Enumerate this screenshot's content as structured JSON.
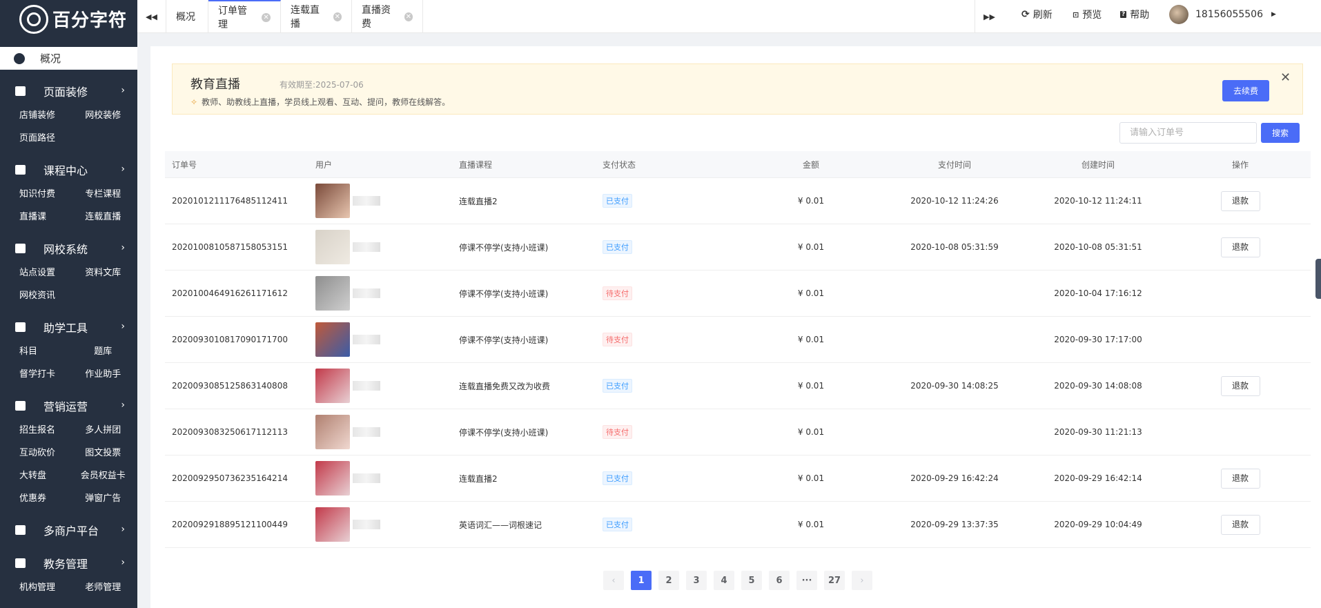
{
  "brand": {
    "name": "百分字符"
  },
  "sidebar": {
    "active": "概况",
    "groups": [
      {
        "title": "页面装修",
        "items": [
          "店铺装修",
          "网校装修",
          "页面路径"
        ]
      },
      {
        "title": "课程中心",
        "items": [
          "知识付费",
          "专栏课程",
          "直播课",
          "连载直播"
        ]
      },
      {
        "title": "网校系统",
        "items": [
          "站点设置",
          "资料文库",
          "网校资讯"
        ]
      },
      {
        "title": "助学工具",
        "items": [
          "科目",
          "题库",
          "督学打卡",
          "作业助手"
        ]
      },
      {
        "title": "营销运营",
        "items": [
          "招生报名",
          "多人拼团",
          "互动砍价",
          "图文投票",
          "大转盘",
          "会员权益卡",
          "优惠券",
          "弹窗广告"
        ]
      },
      {
        "title": "多商户平台",
        "items": []
      },
      {
        "title": "教务管理",
        "items": [
          "机构管理",
          "老师管理"
        ]
      }
    ]
  },
  "topbar": {
    "prev_icon": "◀◀",
    "next_icon": "▶▶",
    "tabs": [
      {
        "label": "概况",
        "closable": false
      },
      {
        "label": "订单管理",
        "closable": true,
        "active": true
      },
      {
        "label": "连载直播",
        "closable": true
      },
      {
        "label": "直播资费",
        "closable": true
      }
    ],
    "refresh": "刷新",
    "preview": "预览",
    "help": "帮助",
    "user": "18156055506"
  },
  "notice": {
    "title": "教育直播",
    "expiry": "有效期至:2025-07-06",
    "desc": "教师、助教线上直播，学员线上观看、互动、提问，教师在线解答。",
    "renew": "去续费"
  },
  "search": {
    "placeholder": "请输入订单号",
    "button": "搜索"
  },
  "table": {
    "headers": [
      "订单号",
      "用户",
      "直播课程",
      "支付状态",
      "金额",
      "支付时间",
      "创建时间",
      "操作"
    ],
    "rows": [
      {
        "order": "20201012111764851124​11",
        "course": "连载直播2",
        "status": "已支付",
        "paid": true,
        "amount": "¥ 0.01",
        "pay_time": "2020-10-12 11:24:26",
        "create_time": "2020-10-12 11:24:11",
        "action": "退款",
        "c1": "#7a4a3a",
        "c2": "#e8c6b0"
      },
      {
        "order": "20201008105871580531​51",
        "course": "停课不停学(支持小班课)",
        "status": "已支付",
        "paid": true,
        "amount": "¥ 0.01",
        "pay_time": "2020-10-08 05:31:59",
        "create_time": "2020-10-08 05:31:51",
        "action": "退款",
        "c1": "#d8d2c8",
        "c2": "#efeae2"
      },
      {
        "order": "20201004649162611716​12",
        "course": "停课不停学(支持小班课)",
        "status": "待支付",
        "paid": false,
        "amount": "¥ 0.01",
        "pay_time": "",
        "create_time": "2020-10-04 17:16:12",
        "action": "",
        "c1": "#8e8e8e",
        "c2": "#cfcfcf"
      },
      {
        "order": "20200930108170901717​00",
        "course": "停课不停学(支持小班课)",
        "status": "待支付",
        "paid": false,
        "amount": "¥ 0.01",
        "pay_time": "",
        "create_time": "2020-09-30 17:17:00",
        "action": "",
        "c1": "#c05a3a",
        "c2": "#3a5ca8"
      },
      {
        "order": "20200930851258631408​08",
        "course": "连载直播免费又改为收费",
        "status": "已支付",
        "paid": true,
        "amount": "¥ 0.01",
        "pay_time": "2020-09-30 14:08:25",
        "create_time": "2020-09-30 14:08:08",
        "action": "退款",
        "c1": "#c23a4a",
        "c2": "#e8d0d4"
      },
      {
        "order": "20200930832506171121​13",
        "course": "停课不停学(支持小班课)",
        "status": "待支付",
        "paid": false,
        "amount": "¥ 0.01",
        "pay_time": "",
        "create_time": "2020-09-30 11:21:13",
        "action": "",
        "c1": "#b08070",
        "c2": "#f0d8d0"
      },
      {
        "order": "20200929507362351642​14",
        "course": "连载直播2",
        "status": "已支付",
        "paid": true,
        "amount": "¥ 0.01",
        "pay_time": "2020-09-29 16:42:24",
        "create_time": "2020-09-29 16:42:14",
        "action": "退款",
        "c1": "#c23a4a",
        "c2": "#e8d0d4"
      },
      {
        "order": "20200929188951211004​49",
        "course": "英语词汇——词根速记",
        "status": "已支付",
        "paid": true,
        "amount": "¥ 0.01",
        "pay_time": "2020-09-29 13:37:35",
        "create_time": "2020-09-29 10:04:49",
        "action": "退款",
        "c1": "#c23a4a",
        "c2": "#e8d0d4"
      }
    ]
  },
  "pagination": {
    "prev": "‹",
    "next": "›",
    "pages": [
      "1",
      "2",
      "3",
      "4",
      "5",
      "6",
      "···",
      "27"
    ],
    "current": "1"
  }
}
